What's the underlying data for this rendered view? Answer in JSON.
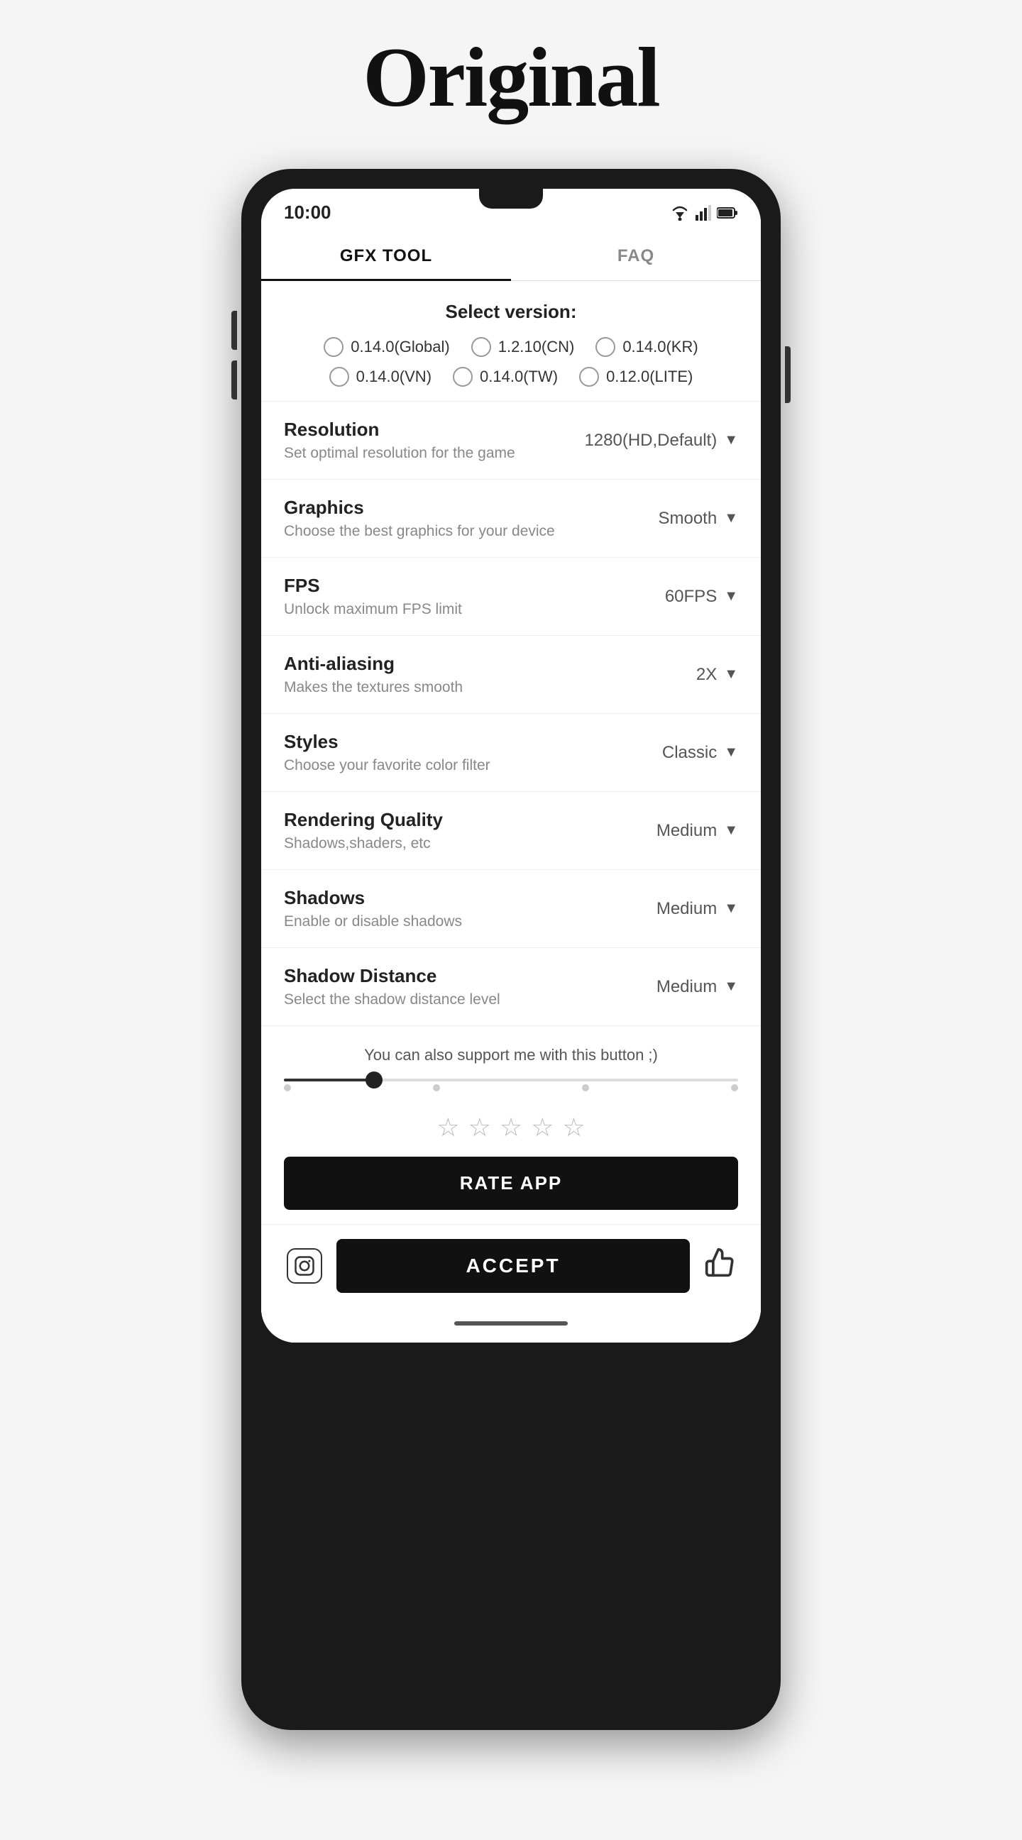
{
  "page": {
    "title": "Original"
  },
  "status_bar": {
    "time": "10:00"
  },
  "tabs": [
    {
      "id": "gfx",
      "label": "GFX TOOL",
      "active": true
    },
    {
      "id": "faq",
      "label": "FAQ",
      "active": false
    }
  ],
  "version_section": {
    "title": "Select version:",
    "options": [
      {
        "id": "global",
        "label": "0.14.0(Global)",
        "selected": false
      },
      {
        "id": "cn",
        "label": "1.2.10(CN)",
        "selected": false
      },
      {
        "id": "kr",
        "label": "0.14.0(KR)",
        "selected": false
      },
      {
        "id": "vn",
        "label": "0.14.0(VN)",
        "selected": false
      },
      {
        "id": "tw",
        "label": "0.14.0(TW)",
        "selected": false
      },
      {
        "id": "lite",
        "label": "0.12.0(LITE)",
        "selected": false
      }
    ]
  },
  "settings": [
    {
      "id": "resolution",
      "name": "Resolution",
      "description": "Set optimal resolution for the game",
      "value": "1280(HD,Default)"
    },
    {
      "id": "graphics",
      "name": "Graphics",
      "description": "Choose the best graphics for your device",
      "value": "Smooth"
    },
    {
      "id": "fps",
      "name": "FPS",
      "description": "Unlock maximum FPS limit",
      "value": "60FPS"
    },
    {
      "id": "antialiasing",
      "name": "Anti-aliasing",
      "description": "Makes the textures smooth",
      "value": "2X"
    },
    {
      "id": "styles",
      "name": "Styles",
      "description": "Choose your favorite color filter",
      "value": "Classic"
    },
    {
      "id": "rendering",
      "name": "Rendering Quality",
      "description": "Shadows,shaders, etc",
      "value": "Medium"
    },
    {
      "id": "shadows",
      "name": "Shadows",
      "description": "Enable or disable shadows",
      "value": "Medium"
    },
    {
      "id": "shadow_distance",
      "name": "Shadow Distance",
      "description": "Select the shadow distance level",
      "value": "Medium"
    }
  ],
  "support": {
    "text": "You can also support me with this button ;)"
  },
  "rating": {
    "stars": [
      "☆",
      "☆",
      "☆",
      "☆",
      "☆"
    ],
    "button_label": "RATE APP"
  },
  "bottom": {
    "accept_label": "ACCEPT",
    "instagram_icon": "instagram",
    "thumbsup_icon": "thumbs-up"
  }
}
